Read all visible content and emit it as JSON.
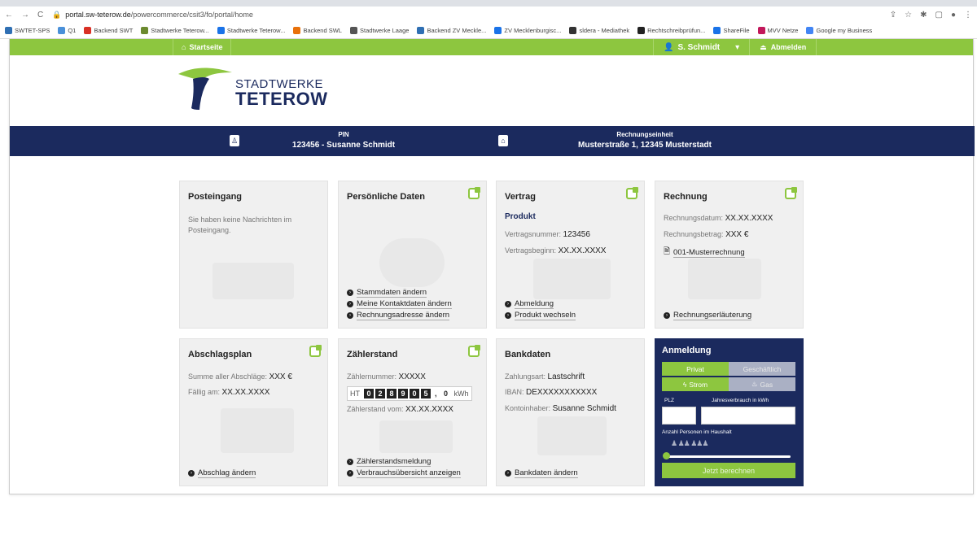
{
  "browser": {
    "url_host": "portal.sw-teterow.de",
    "url_path": "/powercommerce/csit3/fo/portal/home",
    "bookmarks": [
      "SWTET-SPS",
      "Q1",
      "Backend SWT",
      "Stadtwerke Teterow...",
      "Stadtwerke Teterow...",
      "Backend SWL",
      "Stadtwerke Laage",
      "Backend ZV Meckle...",
      "ZV Mecklenburgisc...",
      "sldera - Mediathek",
      "Rechtschreibprüfun...",
      "ShareFile",
      "MVV Netze",
      "Google my Business"
    ]
  },
  "topnav": {
    "home_label": "Startseite",
    "user_label": "S. Schmidt",
    "logout_label": "Abmelden"
  },
  "brand": {
    "line1": "STADTWERKE",
    "line2": "TETEROW",
    "navy": "#1b2a5e",
    "green": "#8dc63f"
  },
  "info": {
    "pin_label": "PIN",
    "pin_value": "123456 - Susanne Schmidt",
    "unit_label": "Rechnungseinheit",
    "unit_value": "Musterstraße 1, 12345 Musterstadt"
  },
  "cards": {
    "posteingang": {
      "title": "Posteingang",
      "text": "Sie haben keine Nachrichten im Posteingang."
    },
    "persoenlich": {
      "title": "Persönliche Daten",
      "links": [
        "Stammdaten ändern",
        "Meine Kontaktdaten ändern",
        "Rechnungsadresse ändern"
      ]
    },
    "vertrag": {
      "title": "Vertrag",
      "subtitle": "Produkt",
      "nr_label": "Vertragsnummer:",
      "nr_value": "123456",
      "beginn_label": "Vertragsbeginn:",
      "beginn_value": "XX.XX.XXXX",
      "links": [
        "Abmeldung",
        "Produkt wechseln"
      ]
    },
    "rechnung": {
      "title": "Rechnung",
      "datum_label": "Rechnungsdatum:",
      "datum_value": "XX.XX.XXXX",
      "betrag_label": "Rechnungsbetrag:",
      "betrag_value": "XXX €",
      "file": "001-Musterrechnung",
      "link": "Rechnungserläuterung"
    },
    "abschlag": {
      "title": "Abschlagsplan",
      "summe_label": "Summe aller Abschläge:",
      "summe_value": "XXX €",
      "faellig_label": "Fällig am:",
      "faellig_value": "XX.XX.XXXX",
      "link": "Abschlag ändern"
    },
    "zaehler": {
      "title": "Zählerstand",
      "nr_label": "Zählernummer:",
      "nr_value": "XXXXX",
      "prefix": "HT",
      "digits": [
        "0",
        "2",
        "8",
        "9",
        "0",
        "5"
      ],
      "sep": ",",
      "decimal": "0",
      "unit": "kWh",
      "vom_label": "Zählerstand vom:",
      "vom_value": "XX.XX.XXXX",
      "links": [
        "Zählerstandsmeldung",
        "Verbrauchsübersicht anzeigen"
      ]
    },
    "bank": {
      "title": "Bankdaten",
      "art_label": "Zahlungsart:",
      "art_value": "Lastschrift",
      "iban_label": "IBAN:",
      "iban_value": "DEXXXXXXXXXXX",
      "inhaber_label": "Kontoinhaber:",
      "inhaber_value": "Susanne Schmidt",
      "link": "Bankdaten ändern"
    }
  },
  "anmeldung": {
    "title": "Anmeldung",
    "tab_private": "Privat",
    "tab_business": "Geschäftlich",
    "tab_strom": "Strom",
    "tab_gas": "Gas",
    "plz_label": "PLZ",
    "verbrauch_label": "Jahresverbrauch in kWh",
    "personen_label": "Anzahl Personen im Haushalt",
    "persons_level": 1,
    "button": "Jetzt berechnen"
  }
}
